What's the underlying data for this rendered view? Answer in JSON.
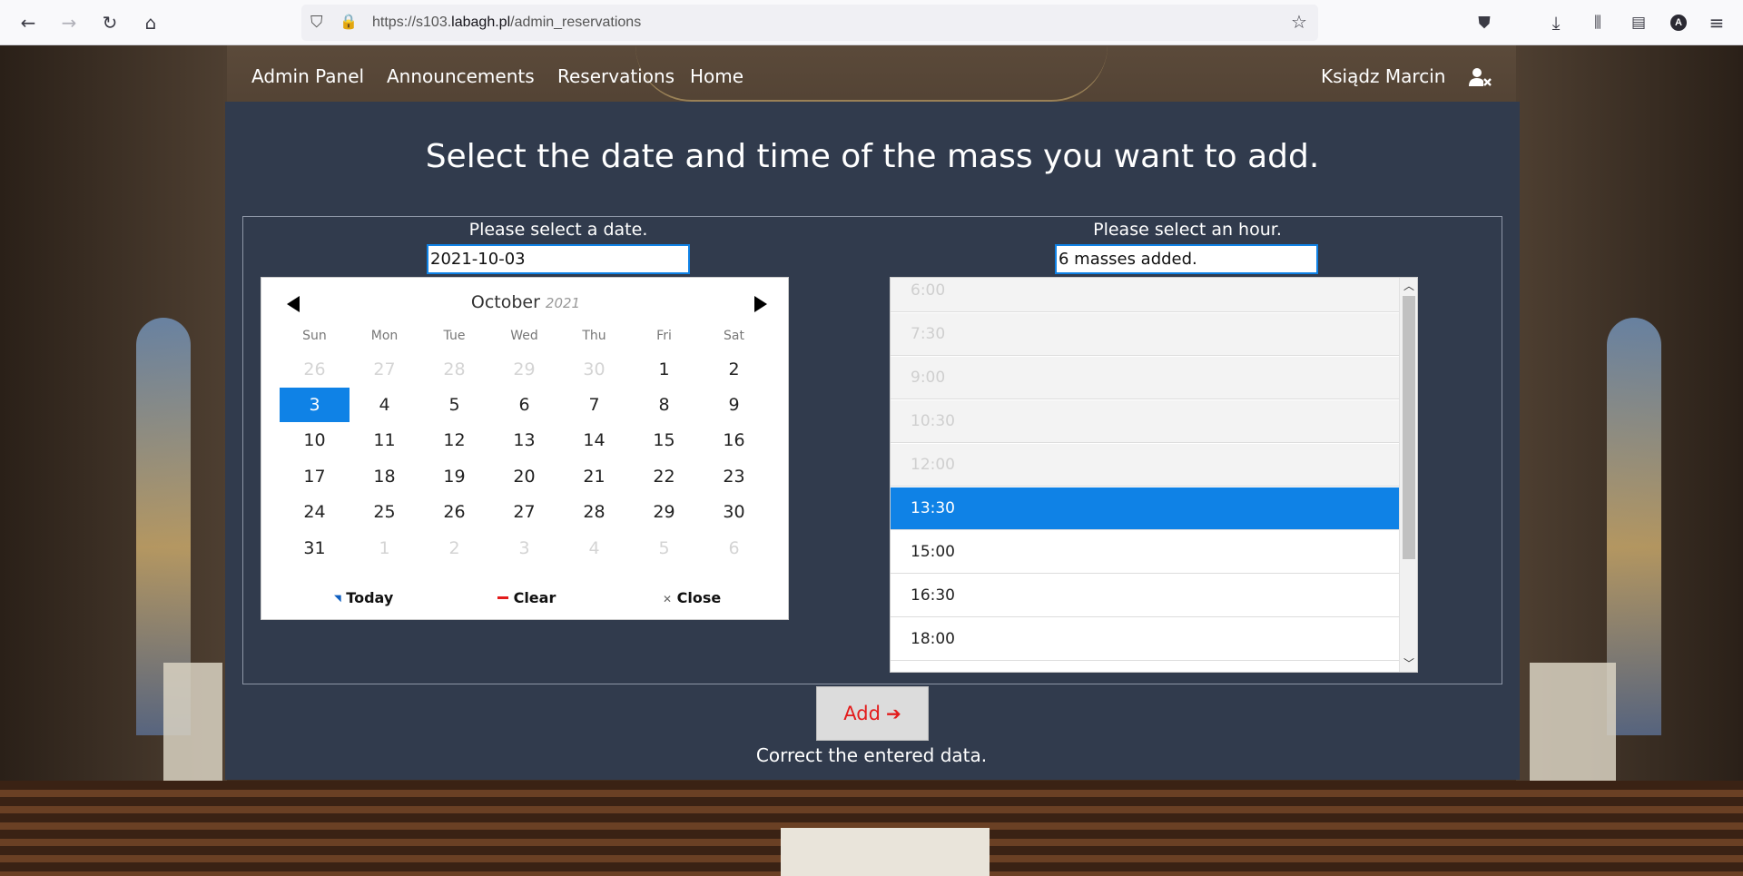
{
  "browser": {
    "url_prefix": "https://s103.",
    "url_domain": "labagh.pl",
    "url_path": "/admin_reservations",
    "profile_initial": "A"
  },
  "nav": {
    "links": [
      "Admin Panel",
      "Announcements",
      "Reservations",
      "Home"
    ],
    "user_name": "Ksiądz Marcin"
  },
  "page": {
    "heading": "Select the date and time of the mass you want to add.",
    "date_label": "Please select a date.",
    "date_value": "2021-10-03",
    "hour_label": "Please select an hour.",
    "hour_value": "6 masses added."
  },
  "calendar": {
    "month": "October",
    "year": "2021",
    "weekdays": [
      "Sun",
      "Mon",
      "Tue",
      "Wed",
      "Thu",
      "Fri",
      "Sat"
    ],
    "weeks": [
      [
        "26",
        "27",
        "28",
        "29",
        "30",
        "1",
        "2"
      ],
      [
        "3",
        "4",
        "5",
        "6",
        "7",
        "8",
        "9"
      ],
      [
        "10",
        "11",
        "12",
        "13",
        "14",
        "15",
        "16"
      ],
      [
        "17",
        "18",
        "19",
        "20",
        "21",
        "22",
        "23"
      ],
      [
        "24",
        "25",
        "26",
        "27",
        "28",
        "29",
        "30"
      ],
      [
        "31",
        "1",
        "2",
        "3",
        "4",
        "5",
        "6"
      ]
    ],
    "selected_day": "3",
    "today_label": "Today",
    "clear_label": "Clear",
    "close_label": "Close"
  },
  "hours": [
    {
      "time": "6:00",
      "state": "disabled"
    },
    {
      "time": "7:30",
      "state": "disabled"
    },
    {
      "time": "9:00",
      "state": "disabled"
    },
    {
      "time": "10:30",
      "state": "disabled"
    },
    {
      "time": "12:00",
      "state": "disabled"
    },
    {
      "time": "13:30",
      "state": "active"
    },
    {
      "time": "15:00",
      "state": "normal"
    },
    {
      "time": "16:30",
      "state": "normal"
    },
    {
      "time": "18:00",
      "state": "normal"
    }
  ],
  "actions": {
    "add_label": "Add",
    "message": "Correct the entered data."
  },
  "colors": {
    "accent": "#0f82e6",
    "panel": "#313b4d",
    "add_text": "#e31b1b"
  }
}
